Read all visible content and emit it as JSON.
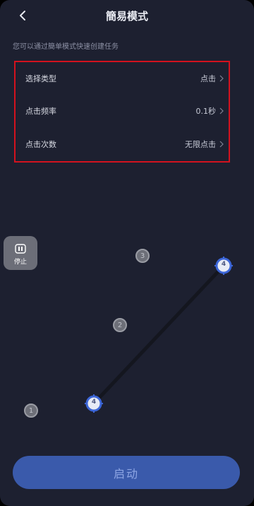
{
  "header": {
    "title": "簡易模式"
  },
  "subtitle": "您可以通过簡单模式快速创建任务",
  "settings": {
    "rows": [
      {
        "label": "选择类型",
        "value": "点击"
      },
      {
        "label": "点击频率",
        "value": "0.1秒"
      },
      {
        "label": "点击次数",
        "value": "无限点击"
      }
    ]
  },
  "stop_button": {
    "label": "停止"
  },
  "points": [
    {
      "label": "1"
    },
    {
      "label": "2"
    },
    {
      "label": "3"
    }
  ],
  "targets": [
    {
      "label": "4"
    },
    {
      "label": "4"
    }
  ],
  "start_button": {
    "label": "启动"
  },
  "colors": {
    "background": "#1d2030",
    "highlight_border": "#d3121e",
    "primary_button": "#3a5aab",
    "target_ring": "#3c66d8"
  }
}
